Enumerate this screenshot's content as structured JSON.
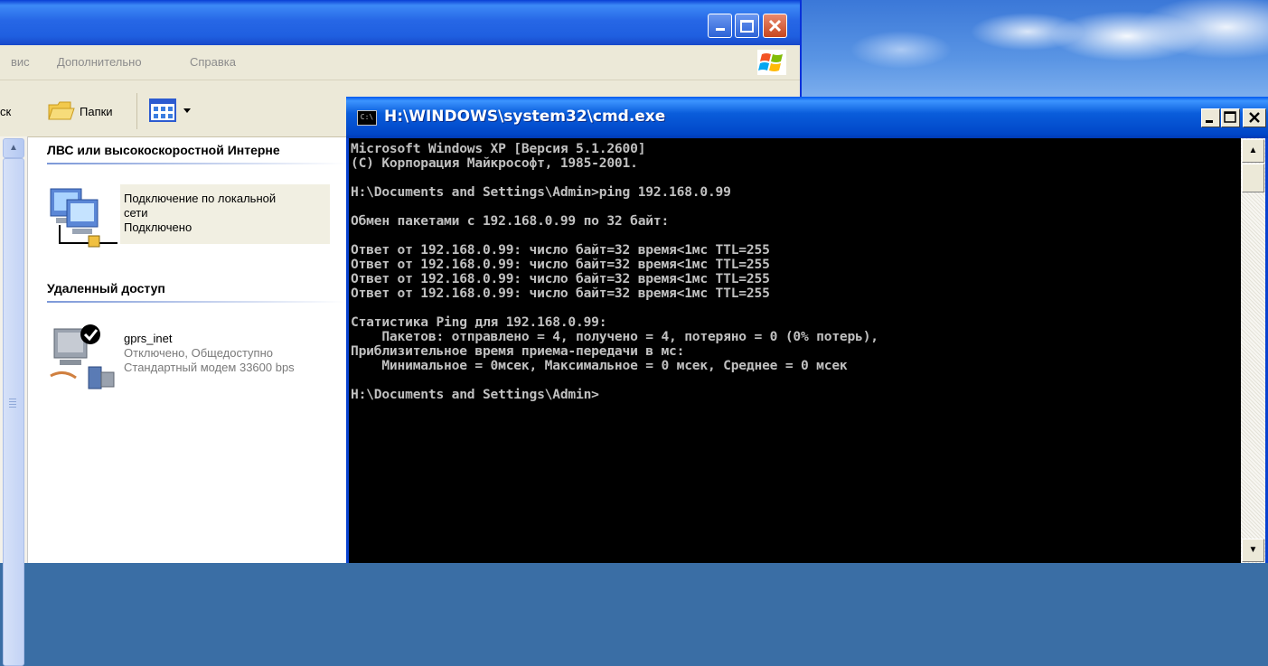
{
  "explorer": {
    "menu": [
      "вис",
      "Дополнительно",
      "Справка"
    ],
    "toolbar": {
      "search_partial": "ск",
      "folders_label": "Папки"
    },
    "groups": {
      "lan_header": "ЛВС или высокоскоростной Интерне",
      "remote_header": "Удаленный доступ"
    },
    "connections": {
      "lan": {
        "name_line1": "Подключение по локальной",
        "name_line2": "сети",
        "status": "Подключено"
      },
      "gprs": {
        "name": "gprs_inet",
        "status": "Отключено, Общедоступно",
        "device": "Стандартный модем 33600 bps"
      }
    }
  },
  "cmd": {
    "title": "H:\\WINDOWS\\system32\\cmd.exe",
    "icon_text": "C:\\",
    "lines": [
      "Microsoft Windows XP [Версия 5.1.2600]",
      "(С) Корпорация Майкрософт, 1985-2001.",
      "",
      "H:\\Documents and Settings\\Admin>ping 192.168.0.99",
      "",
      "Обмен пакетами с 192.168.0.99 по 32 байт:",
      "",
      "Ответ от 192.168.0.99: число байт=32 время<1мс TTL=255",
      "Ответ от 192.168.0.99: число байт=32 время<1мс TTL=255",
      "Ответ от 192.168.0.99: число байт=32 время<1мс TTL=255",
      "Ответ от 192.168.0.99: число байт=32 время<1мс TTL=255",
      "",
      "Статистика Ping для 192.168.0.99:",
      "    Пакетов: отправлено = 4, получено = 4, потеряно = 0 (0% потерь),",
      "Приблизительное время приема-передачи в мс:",
      "    Минимальное = 0мсек, Максимальное = 0 мсек, Среднее = 0 мсек",
      "",
      "H:\\Documents and Settings\\Admin>"
    ]
  }
}
